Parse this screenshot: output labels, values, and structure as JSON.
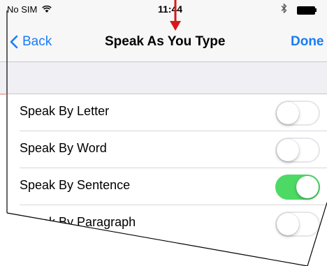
{
  "status_bar": {
    "carrier": "No SIM",
    "wifi_icon": "wifi-icon",
    "time": "11:44",
    "bluetooth_icon": "bluetooth-icon",
    "battery_icon": "battery-icon"
  },
  "nav": {
    "back_label": "Back",
    "title": "Speak As You Type",
    "done_label": "Done"
  },
  "rows": [
    {
      "label": "Speak By Letter",
      "enabled": false
    },
    {
      "label": "Speak By Word",
      "enabled": false
    },
    {
      "label": "Speak By Sentence",
      "enabled": true
    },
    {
      "label": "Speak By Paragraph",
      "enabled": false
    }
  ],
  "colors": {
    "accent": "#1a7cf5",
    "switch_on": "#4cd964",
    "annotation_arrow": "#d7191c"
  }
}
